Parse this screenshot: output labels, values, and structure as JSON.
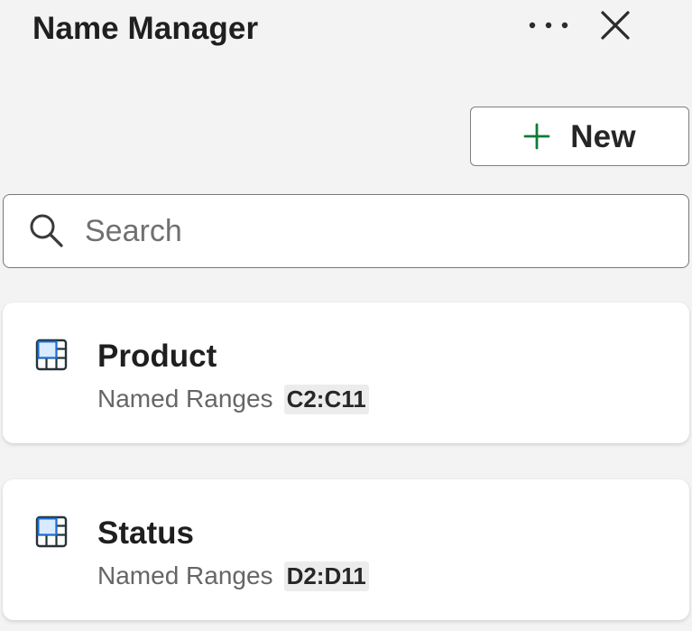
{
  "header": {
    "title": "Name Manager",
    "more_icon": "more-horizontal-icon",
    "close_icon": "close-icon"
  },
  "actions": {
    "new_label": "New",
    "new_icon": "plus-icon",
    "accent_color": "#0f7b36"
  },
  "search": {
    "placeholder": "Search",
    "value": "",
    "icon": "search-icon"
  },
  "names": [
    {
      "name": "Product",
      "type": "Named Ranges",
      "range": "C2:C11",
      "icon": "table-range-icon",
      "icon_color": "#1d6fd1"
    },
    {
      "name": "Status",
      "type": "Named Ranges",
      "range": "D2:D11",
      "icon": "table-range-icon",
      "icon_color": "#1d6fd1"
    }
  ]
}
